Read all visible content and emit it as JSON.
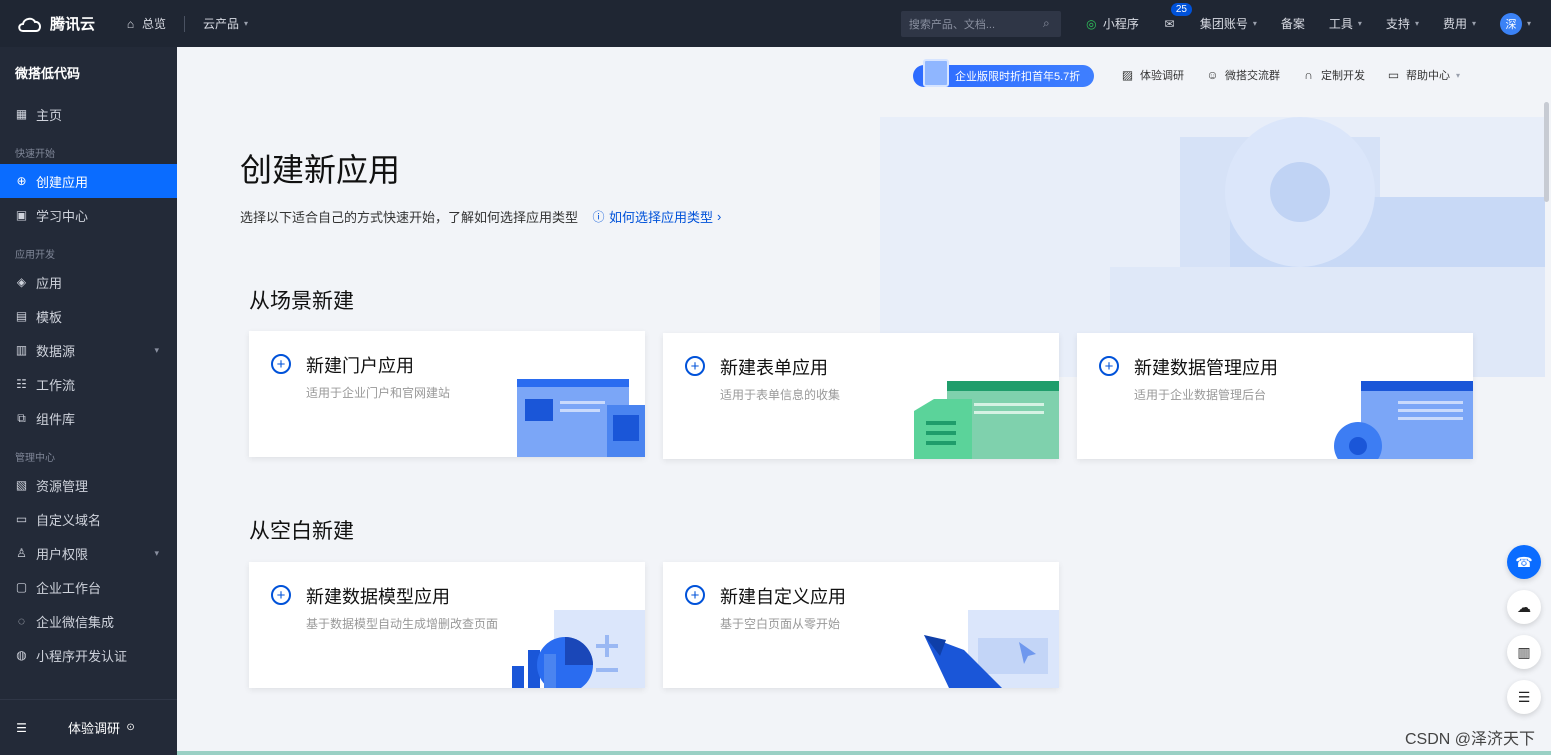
{
  "topbar": {
    "brand": "腾讯云",
    "overview": "总览",
    "products": "云产品",
    "search_placeholder": "搜索产品、文档...",
    "miniprogram": "小程序",
    "mail_badge": "25",
    "account": "集团账号",
    "record": "备案",
    "tools": "工具",
    "support": "支持",
    "billing": "费用",
    "avatar": "深"
  },
  "sidebar": {
    "title": "微搭低代码",
    "home": "主页",
    "section_quick": "快速开始",
    "create_app": "创建应用",
    "learning": "学习中心",
    "section_dev": "应用开发",
    "apps": "应用",
    "templates": "模板",
    "datasource": "数据源",
    "workflow": "工作流",
    "components": "组件库",
    "section_admin": "管理中心",
    "resources": "资源管理",
    "domain": "自定义域名",
    "permissions": "用户权限",
    "workspace": "企业工作台",
    "wecom": "企业微信集成",
    "mp_auth": "小程序开发认证",
    "survey": "体验调研"
  },
  "header": {
    "promo": "企业版限时折扣首年5.7折",
    "survey": "体验调研",
    "group": "微搭交流群",
    "custom_dev": "定制开发",
    "help": "帮助中心"
  },
  "main": {
    "title": "创建新应用",
    "subtitle": "选择以下适合自己的方式快速开始，了解如何选择应用类型",
    "help_link": "如何选择应用类型",
    "section_scene": "从场景新建",
    "section_blank": "从空白新建",
    "cards_scene": [
      {
        "title": "新建门户应用",
        "desc": "适用于企业门户和官网建站"
      },
      {
        "title": "新建表单应用",
        "desc": "适用于表单信息的收集"
      },
      {
        "title": "新建数据管理应用",
        "desc": "适用于企业数据管理后台"
      }
    ],
    "cards_blank": [
      {
        "title": "新建数据模型应用",
        "desc": "基于数据模型自动生成增删改查页面"
      },
      {
        "title": "新建自定义应用",
        "desc": "基于空白页面从零开始"
      }
    ]
  },
  "watermark": "CSDN @泽济天下",
  "colors": {
    "primary": "#0a6cff",
    "topbar": "#1f2633",
    "sidebar": "#232a38"
  }
}
